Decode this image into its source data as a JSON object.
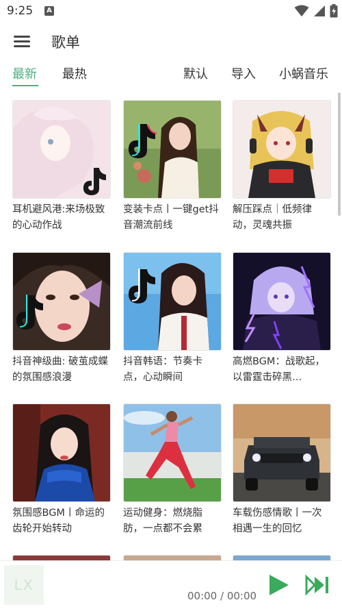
{
  "status": {
    "time": "9:25",
    "a_icon": "A"
  },
  "header": {
    "title": "歌单",
    "menu_icon": "hamburger-menu-icon"
  },
  "tabs": {
    "newest": "最新",
    "hottest": "最热",
    "default": "默认",
    "import": "导入",
    "source": "小蜗音乐"
  },
  "playlists": [
    {
      "title": "耳机避风港:来场极致的心动作战"
    },
    {
      "title": "变装卡点丨一键get抖音潮流前线"
    },
    {
      "title": "解压踩点｜低频律动，灵魂共振"
    },
    {
      "title": "抖音神级曲: 破茧成蝶的氛围感浪漫"
    },
    {
      "title": "抖音韩语：节奏卡点，心动瞬间"
    },
    {
      "title": "高燃BGM：战歌起，以雷霆击碎黑…"
    },
    {
      "title": "氛围感BGM丨命运的齿轮开始转动"
    },
    {
      "title": "运动健身：燃烧脂肪，一点都不会累"
    },
    {
      "title": "车载伤感情歌丨一次相遇一生的回忆"
    }
  ],
  "player": {
    "logo": "LX",
    "time": "00:00 / 00:00"
  },
  "colors": {
    "accent": "#4caf7d",
    "play": "#3aaa5c"
  }
}
